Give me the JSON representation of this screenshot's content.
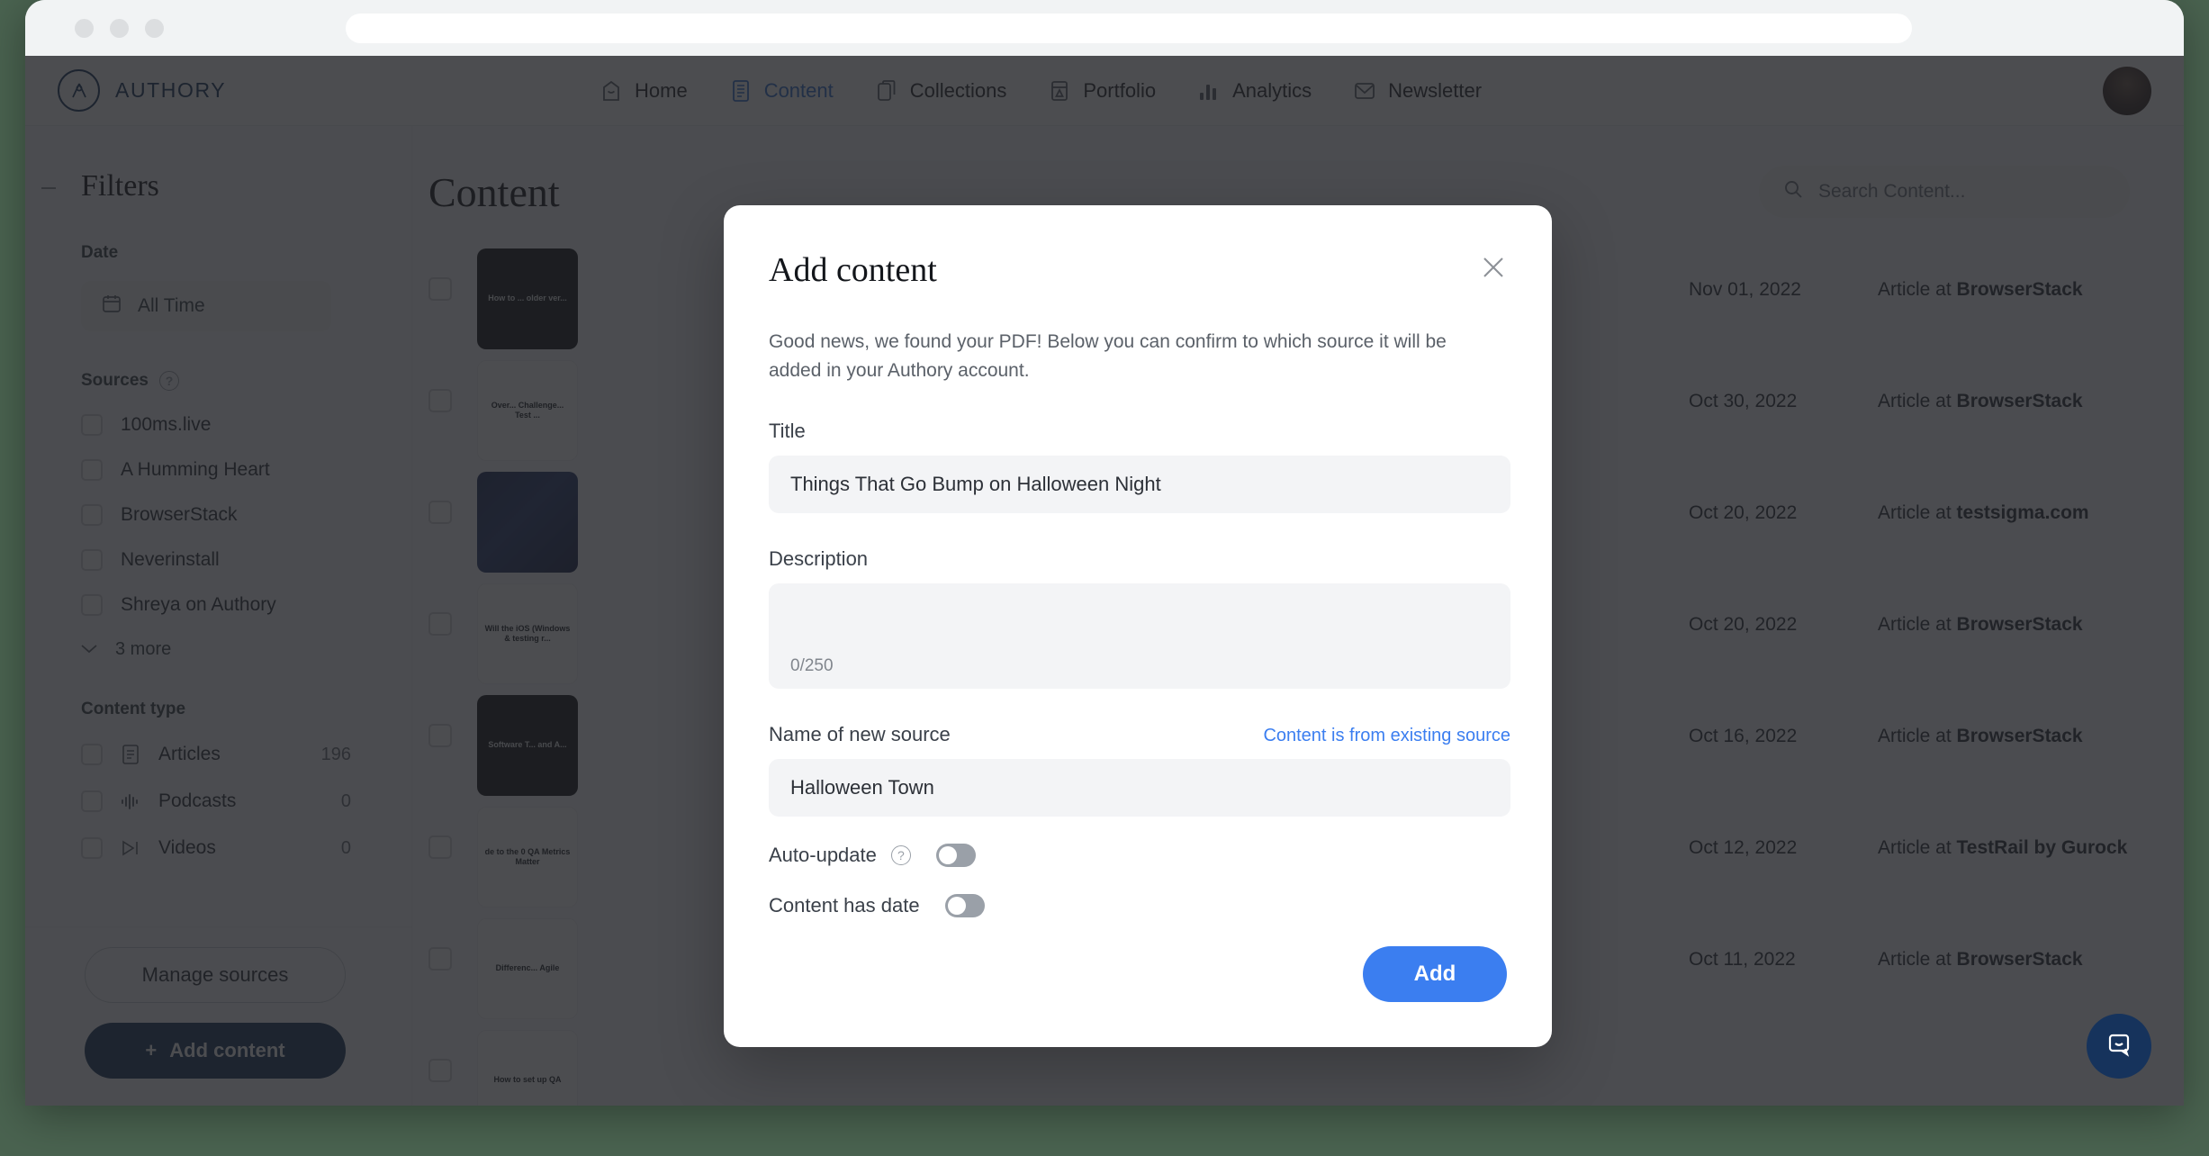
{
  "browser": {
    "url_value": ""
  },
  "topnav": {
    "brand": "AUTHORY",
    "items": [
      {
        "label": "Home",
        "icon": "home-icon",
        "active": false
      },
      {
        "label": "Content",
        "icon": "content-icon",
        "active": true
      },
      {
        "label": "Collections",
        "icon": "collections-icon",
        "active": false
      },
      {
        "label": "Portfolio",
        "icon": "portfolio-icon",
        "active": false
      },
      {
        "label": "Analytics",
        "icon": "analytics-icon",
        "active": false
      },
      {
        "label": "Newsletter",
        "icon": "newsletter-icon",
        "active": false
      }
    ]
  },
  "sidebar": {
    "title": "Filters",
    "date_label": "Date",
    "date_value": "All Time",
    "sources_label": "Sources",
    "sources": [
      {
        "label": "100ms.live"
      },
      {
        "label": "A Humming Heart"
      },
      {
        "label": "BrowserStack"
      },
      {
        "label": "Neverinstall"
      },
      {
        "label": "Shreya on Authory"
      }
    ],
    "more_label": "3 more",
    "content_type_label": "Content type",
    "content_types": [
      {
        "label": "Articles",
        "count": "196",
        "icon": "document-icon"
      },
      {
        "label": "Podcasts",
        "count": "0",
        "icon": "waveform-icon"
      },
      {
        "label": "Videos",
        "count": "0",
        "icon": "video-icon"
      }
    ],
    "manage_sources_label": "Manage sources",
    "add_content_label": "Add content"
  },
  "main": {
    "page_title": "Content",
    "search_placeholder": "Search Content...",
    "rows": [
      {
        "thumb_kind": "dark",
        "thumb_text": "How to ... older ver...",
        "title": "",
        "date": "Nov 01, 2022",
        "src_prefix": "Article at ",
        "src": "BrowserStack"
      },
      {
        "thumb_kind": "light",
        "thumb_text": "Over... Challenge... Test ...",
        "title": "",
        "date": "Oct 30, 2022",
        "src_prefix": "Article at ",
        "src": "BrowserStack"
      },
      {
        "thumb_kind": "img",
        "thumb_text": "",
        "title": "",
        "date": "Oct 20, 2022",
        "src_prefix": "Article at ",
        "src": "testsigma.com"
      },
      {
        "thumb_kind": "light",
        "thumb_text": "Will the iOS (Windows & testing r...",
        "title": "",
        "date": "Oct 20, 2022",
        "src_prefix": "Article at ",
        "src": "BrowserStack"
      },
      {
        "thumb_kind": "dark",
        "thumb_text": "Software T... and A...",
        "title": "",
        "date": "Oct 16, 2022",
        "src_prefix": "Article at ",
        "src": "BrowserStack"
      },
      {
        "thumb_kind": "light",
        "thumb_text": "de to the 0 QA Metrics Matter",
        "title": "",
        "date": "Oct 12, 2022",
        "src_prefix": "Article at ",
        "src": "TestRail by Gurock"
      },
      {
        "thumb_kind": "light",
        "thumb_text": "Differenc... Agile",
        "title": "",
        "date": "Oct 11, 2022",
        "src_prefix": "Article at ",
        "src": "BrowserStack"
      },
      {
        "thumb_kind": "light",
        "thumb_text": "How to set up QA",
        "title": "",
        "date": "",
        "src_prefix": "",
        "src": ""
      }
    ]
  },
  "modal": {
    "title": "Add content",
    "close_label": "×",
    "description": "Good news, we found your PDF! Below you can confirm to which source it will be added in your Authory account.",
    "title_field_label": "Title",
    "title_field_value": "Things That Go Bump on Halloween Night",
    "description_field_label": "Description",
    "description_field_value": "",
    "description_placeholder": "",
    "description_counter": "0/250",
    "source_field_label": "Name of new source",
    "source_existing_link": "Content is from existing source",
    "source_field_value": "Halloween Town",
    "autoupdate_label": "Auto-update",
    "autoupdate_on": false,
    "content_has_date_label": "Content has date",
    "content_has_date_on": false,
    "add_button_label": "Add"
  },
  "colors": {
    "brand_navy": "#16335c",
    "accent_blue": "#3b7ef0",
    "nav_active": "#2f6fd0",
    "field_bg": "#f3f4f6",
    "scrim": "rgba(31,33,36,0.80)"
  }
}
